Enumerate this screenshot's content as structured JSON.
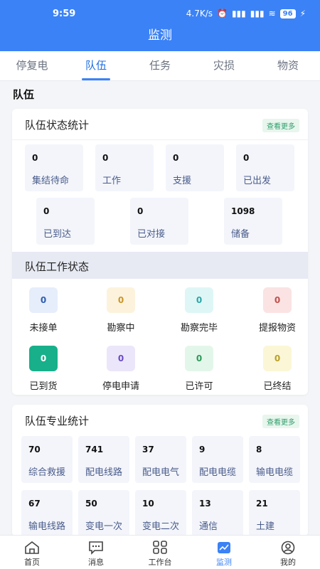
{
  "status_bar": {
    "time": "9:59",
    "network_speed": "4.7K/s",
    "battery": "96"
  },
  "app_bar": {
    "title": "监测"
  },
  "tabs": [
    {
      "label": "停复电"
    },
    {
      "label": "队伍"
    },
    {
      "label": "任务"
    },
    {
      "label": "灾损"
    },
    {
      "label": "物资"
    }
  ],
  "section": {
    "title": "队伍"
  },
  "team_status": {
    "title": "队伍状态统计",
    "more": "查看更多",
    "items": [
      {
        "value": "0",
        "label": "集结待命"
      },
      {
        "value": "0",
        "label": "工作"
      },
      {
        "value": "0",
        "label": "支援"
      },
      {
        "value": "0",
        "label": "已出发"
      },
      {
        "value": "0",
        "label": "已到达"
      },
      {
        "value": "0",
        "label": "已对接"
      },
      {
        "value": "1098",
        "label": "储备"
      }
    ]
  },
  "work_status": {
    "title": "队伍工作状态",
    "items": [
      {
        "value": "0",
        "label": "未接单",
        "bg": "#e6edfb",
        "fg": "#2f5fb0"
      },
      {
        "value": "0",
        "label": "勘察中",
        "bg": "#fdf3dc",
        "fg": "#c9962a"
      },
      {
        "value": "0",
        "label": "勘察完毕",
        "bg": "#dff6f6",
        "fg": "#2aa7a7"
      },
      {
        "value": "0",
        "label": "提报物资",
        "bg": "#fbe3e3",
        "fg": "#c0504d"
      },
      {
        "value": "0",
        "label": "已到货",
        "bg": "#17b08a",
        "fg": "#ffffff"
      },
      {
        "value": "0",
        "label": "停电申请",
        "bg": "#ece6fa",
        "fg": "#6a4bc4"
      },
      {
        "value": "0",
        "label": "已许可",
        "bg": "#e3f6ea",
        "fg": "#2d9a5a"
      },
      {
        "value": "0",
        "label": "已终结",
        "bg": "#fbf6d6",
        "fg": "#b8a12a"
      }
    ]
  },
  "professional": {
    "title": "队伍专业统计",
    "more": "查看更多",
    "items": [
      {
        "value": "70",
        "label": "综合救援"
      },
      {
        "value": "741",
        "label": "配电线路"
      },
      {
        "value": "37",
        "label": "配电电气"
      },
      {
        "value": "9",
        "label": "配电电缆"
      },
      {
        "value": "8",
        "label": "输电电缆"
      },
      {
        "value": "67",
        "label": "输电线路"
      },
      {
        "value": "50",
        "label": "变电一次"
      },
      {
        "value": "10",
        "label": "变电二次"
      },
      {
        "value": "13",
        "label": "通信"
      },
      {
        "value": "21",
        "label": "土建"
      }
    ]
  },
  "bottom_nav": [
    {
      "label": "首页",
      "icon": "home-icon"
    },
    {
      "label": "消息",
      "icon": "message-icon"
    },
    {
      "label": "工作台",
      "icon": "workbench-icon"
    },
    {
      "label": "监测",
      "icon": "monitor-icon"
    },
    {
      "label": "我的",
      "icon": "profile-icon"
    }
  ],
  "colors": {
    "primary": "#3b82f6",
    "more_badge": "#2f9e6b"
  }
}
